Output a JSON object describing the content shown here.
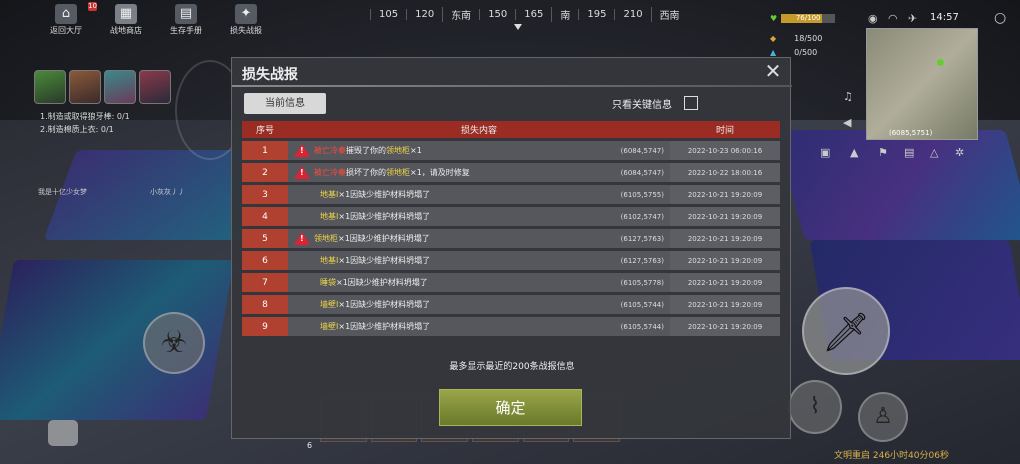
{
  "nav": {
    "items": [
      {
        "label": "返回大厅",
        "icon": "home-icon"
      },
      {
        "label": "战地商店",
        "icon": "shop-icon"
      },
      {
        "label": "生存手册",
        "icon": "book-icon"
      },
      {
        "label": "损失战报",
        "icon": "loss-report-icon"
      }
    ],
    "badge": "10"
  },
  "compass": [
    "105",
    "120",
    "东南",
    "150",
    "165",
    "南",
    "195",
    "210",
    "西南"
  ],
  "tasks": [
    {
      "label": "1.制造或取得狼牙棒: 0/1"
    },
    {
      "label": "2.制造棉质上衣: 0/1"
    }
  ],
  "players": {
    "left": "我是十亿少女梦",
    "right": "小灰灰丿丿"
  },
  "hud": {
    "health": "76/100",
    "health_fraction": 0.76,
    "food": "18/500",
    "water": "0/500",
    "clock": "14:57",
    "map_coords": "(6085,5751)"
  },
  "modal": {
    "title": "损失战报",
    "tab_current": "当前信息",
    "key_only_label": "只看关键信息",
    "columns": [
      "序号",
      "损失内容",
      "时间"
    ],
    "rows": [
      {
        "idx": "1",
        "warn": true,
        "parts": [
          {
            "t": "被亡冷秦",
            "c": "red"
          },
          {
            "t": "摧毁了你的",
            "c": ""
          },
          {
            "t": "领地柜",
            "c": "yellow"
          },
          {
            "t": "×1",
            "c": ""
          }
        ],
        "coord": "(6084,5747)",
        "time": "2022-10-23 06:00:16"
      },
      {
        "idx": "2",
        "warn": true,
        "parts": [
          {
            "t": "被亡冷秦",
            "c": "red"
          },
          {
            "t": "损坏了你的",
            "c": ""
          },
          {
            "t": "领地柜",
            "c": "yellow"
          },
          {
            "t": "×1，请及时修复",
            "c": ""
          }
        ],
        "coord": "(6084,5747)",
        "time": "2022-10-22 18:00:16"
      },
      {
        "idx": "3",
        "warn": false,
        "parts": [
          {
            "t": "地基Ⅰ",
            "c": "yellow"
          },
          {
            "t": "×1因缺少维护材料坍塌了",
            "c": ""
          }
        ],
        "coord": "(6105,5755)",
        "time": "2022-10-21 19:20:09"
      },
      {
        "idx": "4",
        "warn": false,
        "parts": [
          {
            "t": "地基Ⅰ",
            "c": "yellow"
          },
          {
            "t": "×1因缺少维护材料坍塌了",
            "c": ""
          }
        ],
        "coord": "(6102,5747)",
        "time": "2022-10-21 19:20:09"
      },
      {
        "idx": "5",
        "warn": true,
        "parts": [
          {
            "t": "领地柜",
            "c": "yellow"
          },
          {
            "t": "×1因缺少维护材料坍塌了",
            "c": ""
          }
        ],
        "coord": "(6127,5763)",
        "time": "2022-10-21 19:20:09"
      },
      {
        "idx": "6",
        "warn": false,
        "parts": [
          {
            "t": "地基Ⅰ",
            "c": "yellow"
          },
          {
            "t": "×1因缺少维护材料坍塌了",
            "c": ""
          }
        ],
        "coord": "(6127,5763)",
        "time": "2022-10-21 19:20:09"
      },
      {
        "idx": "7",
        "warn": false,
        "parts": [
          {
            "t": "睡袋",
            "c": "yellow"
          },
          {
            "t": "×1因缺少维护材料坍塌了",
            "c": ""
          }
        ],
        "coord": "(6105,5778)",
        "time": "2022-10-21 19:20:09"
      },
      {
        "idx": "8",
        "warn": false,
        "parts": [
          {
            "t": "墙壁Ⅰ",
            "c": "yellow"
          },
          {
            "t": "×1因缺少维护材料坍塌了",
            "c": ""
          }
        ],
        "coord": "(6105,5744)",
        "time": "2022-10-21 19:20:09"
      },
      {
        "idx": "9",
        "warn": false,
        "parts": [
          {
            "t": "墙壁Ⅰ",
            "c": "yellow"
          },
          {
            "t": "×1因缺少维护材料坍塌了",
            "c": ""
          }
        ],
        "coord": "(6105,5744)",
        "time": "2022-10-21 19:20:09"
      }
    ],
    "footer_note": "最多显示最近的200条战报信息",
    "confirm_label": "确定"
  },
  "bottom": {
    "hotbar_left_num": "6",
    "restart_text": "文明重启 246小时40分06秒"
  },
  "colors": {
    "accent_red": "#9a2c24",
    "highlight_red": "#ff4a3a",
    "highlight_yellow": "#f0d64a",
    "confirm": "#8a963a"
  }
}
